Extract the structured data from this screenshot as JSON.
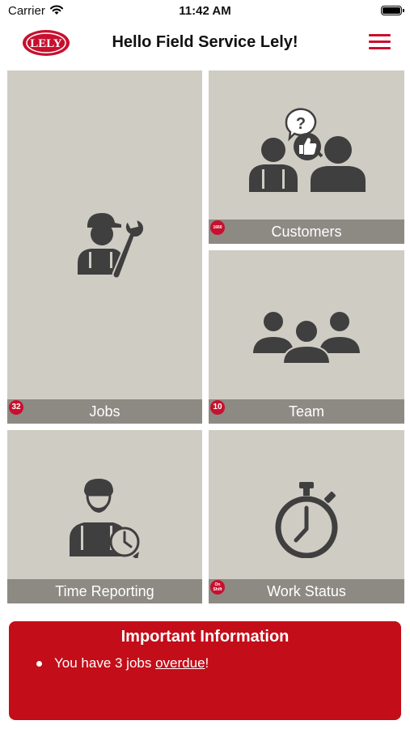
{
  "status_bar": {
    "carrier": "Carrier",
    "time": "11:42 AM"
  },
  "header": {
    "logo_text": "LELY",
    "greeting": "Hello Field Service Lely!"
  },
  "tiles": {
    "jobs": {
      "label": "Jobs",
      "badge": "32",
      "icon": "mechanic-wrench-icon"
    },
    "customers": {
      "label": "Customers",
      "badge": "1660",
      "icon": "customers-chat-icon"
    },
    "team": {
      "label": "Team",
      "badge": "10",
      "icon": "team-icon"
    },
    "time_reporting": {
      "label": "Time Reporting",
      "badge": "",
      "icon": "worker-clock-icon"
    },
    "work_status": {
      "label": "Work Status",
      "badge": "On Shift",
      "icon": "stopwatch-icon"
    }
  },
  "info": {
    "title": "Important Information",
    "item_prefix": "You have 3 jobs ",
    "item_link": "overdue",
    "item_suffix": "!"
  },
  "colors": {
    "brand_red": "#c8102e",
    "tile_bg": "#cfccc3",
    "label_bar": "#8d8a84",
    "icon": "#3f3f3f"
  }
}
